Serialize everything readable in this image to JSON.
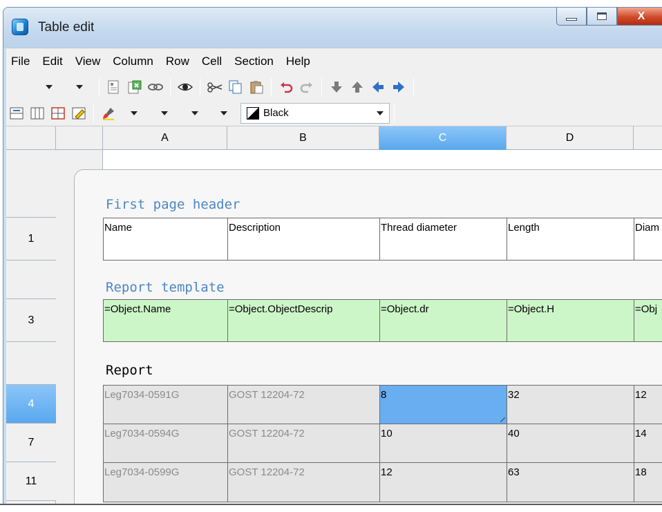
{
  "window": {
    "title": "Table edit",
    "close_glyph": "X"
  },
  "menu": [
    "File",
    "Edit",
    "View",
    "Column",
    "Row",
    "Cell",
    "Section",
    "Help"
  ],
  "toolbar": {
    "color_combo_value": "Black"
  },
  "grid": {
    "columns": [
      "A",
      "B",
      "C",
      "D"
    ],
    "selected_column": "C",
    "row_headers": {
      "r1": "1",
      "r3": "3",
      "r4": "4",
      "r7": "7",
      "r11": "11"
    },
    "sections": {
      "header_title": "First page header",
      "template_title": "Report template",
      "report_title": "Report"
    },
    "header_row": [
      "Name",
      "Description",
      "Thread diameter",
      "Length",
      "Diam"
    ],
    "template_row": [
      "=Object.Name",
      "=Object.ObjectDescrip",
      "=Object.dr",
      "=Object.H",
      "=Obj"
    ],
    "report_rows": [
      [
        "Leg7034-0591G",
        "GOST 12204-72",
        "8",
        "32",
        "12"
      ],
      [
        "Leg7034-0594G",
        "GOST 12204-72",
        "10",
        "40",
        "14"
      ],
      [
        "Leg7034-0599G",
        "GOST 12204-72",
        "12",
        "63",
        "18"
      ]
    ]
  }
}
